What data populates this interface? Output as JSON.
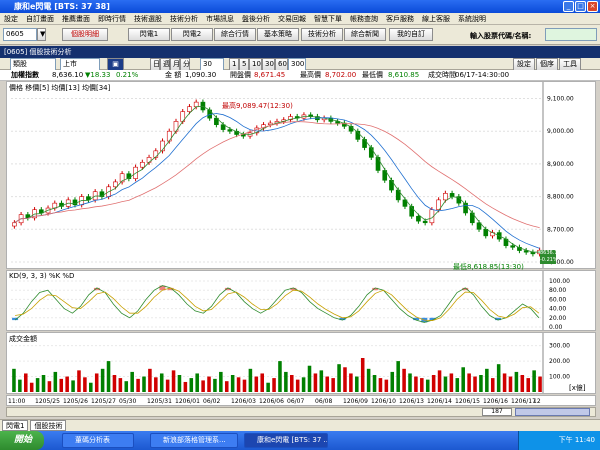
{
  "window": {
    "title": "康和e閃電 [BTS: 37 38]"
  },
  "menu": [
    "設定",
    "自訂畫面",
    "推薦畫面",
    "即時行情",
    "技術選股",
    "技術分析",
    "市場訊息",
    "盤後分析",
    "交易回報",
    "智慧下單",
    "帳務查詢",
    "客戶服務",
    "線上客服",
    "系統說明"
  ],
  "toolbar": {
    "code": "0605",
    "buttons": [
      "個股明細",
      "閃電1",
      "閃電2",
      "綜合行情",
      "基本策略",
      "技術分析",
      "綜合新聞",
      "我的自訂"
    ],
    "search_label": "輸入股票代碼/名稱:"
  },
  "subwindow": {
    "title": "[0605] 個股技術分析"
  },
  "chart_toolbar": {
    "mode": "類股",
    "market": "上市",
    "period_tabs": [
      "日",
      "週",
      "月",
      "分"
    ],
    "interval": "30",
    "minute_tabs": [
      "1",
      "5",
      "10",
      "30",
      "60"
    ],
    "active": "60",
    "count": "300",
    "right_buttons": [
      "設定",
      "個序",
      "工具"
    ]
  },
  "infobar": {
    "name": "加權指數",
    "price": "8,636.10",
    "change": "▼18.33",
    "pct": "0.21%",
    "vol_label": "金 額",
    "vol": "1,090.30",
    "open_label": "開盤價",
    "open": "8,671.45",
    "high_label": "最高價",
    "high": "8,702.00",
    "low_label": "最低價",
    "low": "8,610.85",
    "time_label": "成交時間",
    "time": "06/17-14:30:00"
  },
  "price_panel": {
    "legend": "價格 移價[5] 均價[13] 均價[34]",
    "high_note": "最高9,089.47(12:30)",
    "low_note": "最低8,618.85(13:30)",
    "last_tag": "8636.10",
    "last_pct": "-0.21%",
    "y_ticks": [
      "9,100.00",
      "9,000.00",
      "8,900.00",
      "8,800.00",
      "8,700.00",
      "8,600.00"
    ]
  },
  "kd_panel": {
    "legend": "KD(9, 3, 3) %K %D",
    "y_ticks": [
      "100.00",
      "80.00",
      "60.00",
      "40.00",
      "20.00",
      "0.00"
    ]
  },
  "vol_panel": {
    "legend": "成交金額",
    "y_ticks": [
      "300.00",
      "200.00",
      "100.00"
    ],
    "unit": "[x億]"
  },
  "x_axis": [
    "11:00",
    "1205/25",
    "1205/26",
    "1205/27",
    "05/30",
    "1205/31",
    "1206/01",
    "06/02",
    "1206/03",
    "1206/06",
    "06/07",
    "06/08",
    "1206/09",
    "1206/10",
    "1206/13",
    "1206/14",
    "1206/15",
    "1206/16",
    "1206/17",
    "12"
  ],
  "x_count": "187",
  "chart_data": {
    "type": "line",
    "price": {
      "y_range": [
        8600,
        9120
      ],
      "close": [
        8720,
        8745,
        8735,
        8760,
        8750,
        8765,
        8780,
        8770,
        8790,
        8775,
        8800,
        8790,
        8815,
        8800,
        8830,
        8845,
        8870,
        8855,
        8890,
        8905,
        8920,
        8940,
        8970,
        9000,
        9030,
        9060,
        9075,
        9089,
        9065,
        9040,
        9020,
        9005,
        9000,
        8990,
        8985,
        8995,
        9010,
        9020,
        9025,
        9030,
        9035,
        9045,
        9040,
        9050,
        9045,
        9035,
        9040,
        9030,
        9025,
        9015,
        9000,
        8975,
        8950,
        8920,
        8880,
        8850,
        8820,
        8790,
        8770,
        8740,
        8725,
        8720,
        8760,
        8790,
        8810,
        8800,
        8780,
        8750,
        8720,
        8700,
        8680,
        8690,
        8670,
        8650,
        8645,
        8635,
        8630,
        8625,
        8636
      ]
    },
    "kd": {
      "y_range": [
        0,
        100
      ],
      "k": [
        15,
        30,
        55,
        75,
        80,
        60,
        40,
        30,
        45,
        70,
        85,
        75,
        50,
        30,
        20,
        35,
        60,
        80,
        90,
        85,
        70,
        50,
        35,
        30,
        45,
        70,
        85,
        75,
        55,
        40,
        30,
        40,
        60,
        80,
        85,
        75,
        55,
        40,
        30,
        20,
        15,
        25,
        45,
        70,
        85,
        80,
        60,
        40,
        25,
        15,
        10,
        15,
        25,
        50,
        75,
        85,
        70,
        45,
        25,
        15,
        20,
        35,
        50,
        40,
        20
      ],
      "d": [
        25,
        28,
        40,
        58,
        70,
        68,
        55,
        42,
        40,
        55,
        72,
        76,
        62,
        44,
        30,
        30,
        45,
        65,
        80,
        85,
        78,
        62,
        45,
        35,
        38,
        55,
        72,
        76,
        65,
        50,
        38,
        38,
        50,
        68,
        80,
        78,
        65,
        50,
        38,
        28,
        20,
        22,
        35,
        55,
        73,
        80,
        70,
        52,
        35,
        22,
        15,
        14,
        20,
        38,
        60,
        76,
        75,
        58,
        38,
        24,
        20,
        28,
        42,
        44,
        30
      ]
    },
    "volume": {
      "y_range": [
        0,
        330
      ],
      "values": [
        150,
        80,
        120,
        60,
        90,
        110,
        70,
        130,
        85,
        100,
        75,
        140,
        95,
        60,
        120,
        150,
        200,
        110,
        90,
        70,
        130,
        85,
        100,
        150,
        95,
        120,
        80,
        140,
        110,
        65,
        90,
        120,
        75,
        100,
        85,
        130,
        70,
        110,
        95,
        80,
        150,
        100,
        120,
        60,
        90,
        200,
        130,
        110,
        80,
        95,
        170,
        120,
        140,
        100,
        90,
        180,
        160,
        120,
        100,
        220,
        150,
        110,
        90,
        80,
        130,
        200,
        150,
        120,
        100,
        90,
        80,
        110,
        140,
        100,
        120,
        90,
        160,
        120,
        100,
        110,
        150,
        90,
        180,
        120,
        100,
        130,
        110,
        90,
        140,
        100
      ]
    }
  },
  "bottom_tabs": [
    "閃電1",
    "個股技術"
  ],
  "taskbar": {
    "start": "開始",
    "tasks": [
      "董碼分析表",
      "新浪部落格管理系...",
      "康和e閃電 [BTS: 37 ..."
    ],
    "clock": "下午 11:40"
  }
}
